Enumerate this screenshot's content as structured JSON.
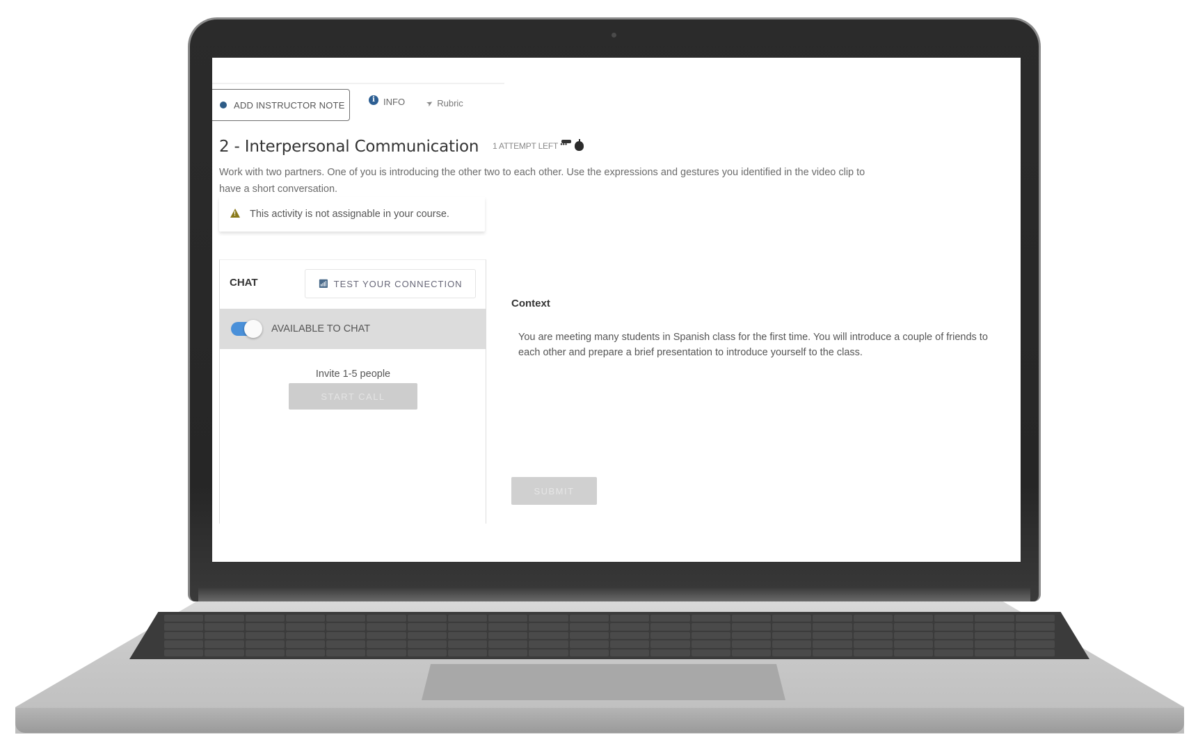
{
  "toolbar": {
    "add_note_label": "ADD INSTRUCTOR NOTE",
    "info_label": "INFO",
    "rubric_label": "Rubric"
  },
  "activity": {
    "title": "2 - Interpersonal Communication",
    "attempts_label": "1 ATTEMPT LEFT",
    "description": "Work with two partners. One of you is introducing the other two to each other. Use the expressions and gestures you identified in the video clip to have a short conversation."
  },
  "alert": {
    "icon": "warning-icon",
    "message": "This activity is not assignable in your course."
  },
  "chat": {
    "header": "CHAT",
    "test_connection_label": "TEST YOUR CONNECTION",
    "available_label": "AVAILABLE TO CHAT",
    "available": true,
    "invite_text": "Invite 1-5 people",
    "start_call_label": "START CALL"
  },
  "context": {
    "title": "Context",
    "text": "You are meeting many students in Spanish class for the first time. You will introduce a couple of friends to each other and prepare a brief presentation to introduce yourself to the class."
  },
  "submit_label": "SUBMIT",
  "colors": {
    "accent": "#2e5c87",
    "toggle_on": "#4a90d9",
    "warning": "#8a7a1a",
    "disabled_button": "#cdcdcd"
  }
}
